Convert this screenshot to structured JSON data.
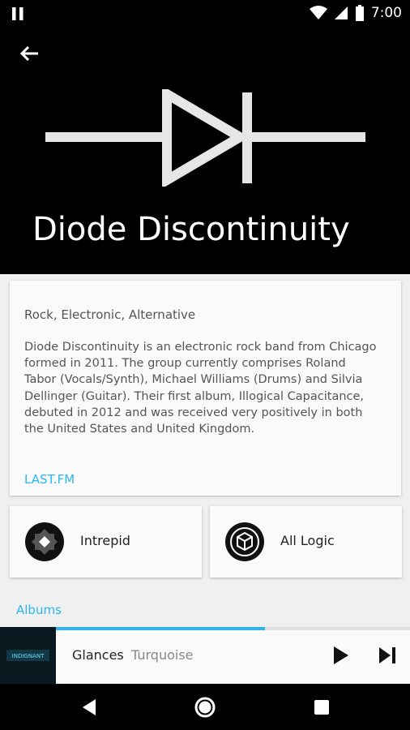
{
  "status_bar": {
    "time": "7:00",
    "icons": [
      "pause-icon",
      "wifi-icon",
      "signal-icon",
      "battery-icon"
    ]
  },
  "header": {
    "artist_name": "Diode Discontinuity",
    "back_icon": "arrow-back-icon",
    "logo_icon": "diode-symbol-icon"
  },
  "bio_card": {
    "genres": "Rock, Electronic, Alternative",
    "bio": "Diode Discontinuity is an electronic rock band from Chicago formed in 2011. The group currently comprises Roland Tabor (Vocals/Synth), Michael Williams (Drums) and Silvia Dellinger (Guitar). Their first album, Illogical Capacitance, debuted in 2012 and was received very positively in both the United States and United Kingdom.",
    "source_link": "LAST.FM"
  },
  "related_artists": [
    {
      "name": "Intrepid",
      "icon": "intrepid-logo-icon"
    },
    {
      "name": "All Logic",
      "icon": "all-logic-logo-icon"
    }
  ],
  "sections": {
    "albums_label": "Albums"
  },
  "now_playing": {
    "track": "Glances",
    "artist": "Turquoise",
    "album_art_text": "INDIGNANT",
    "progress": 0.59
  },
  "colors": {
    "accent": "#29b6f6",
    "header_bg": "#000000",
    "card_bg": "#fafafa"
  }
}
